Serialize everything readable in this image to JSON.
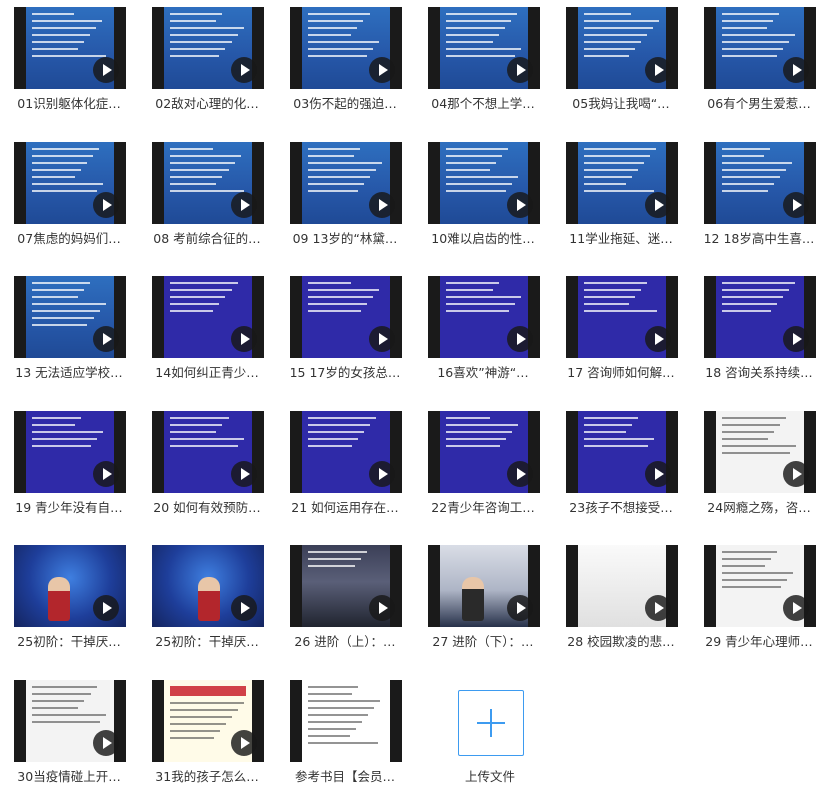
{
  "files": [
    {
      "name": "01识别躯体化症…",
      "style": "blue-doc"
    },
    {
      "name": "02敌对心理的化…",
      "style": "blue"
    },
    {
      "name": "03伤不起的强迫…",
      "style": "blue"
    },
    {
      "name": "04那个不想上学…",
      "style": "blue"
    },
    {
      "name": "05我妈让我喝“…",
      "style": "blue"
    },
    {
      "name": "06有个男生爱惹…",
      "style": "blue"
    },
    {
      "name": "07焦虑的妈妈们…",
      "style": "blue"
    },
    {
      "name": "08 考前综合征的…",
      "style": "blue"
    },
    {
      "name": "09 13岁的“林黛…",
      "style": "blue"
    },
    {
      "name": "10难以启齿的性…",
      "style": "blue"
    },
    {
      "name": "11学业拖延、迷…",
      "style": "blue"
    },
    {
      "name": "12 18岁高中生喜…",
      "style": "blue"
    },
    {
      "name": "13 无法适应学校…",
      "style": "blue"
    },
    {
      "name": "14如何纠正青少…",
      "style": "indigo"
    },
    {
      "name": "15 17岁的女孩总…",
      "style": "indigo"
    },
    {
      "name": "16喜欢”神游“…",
      "style": "indigo"
    },
    {
      "name": "17 咨询师如何解…",
      "style": "indigo"
    },
    {
      "name": "18 咨询关系持续…",
      "style": "indigo"
    },
    {
      "name": "19 青少年没有自…",
      "style": "indigo"
    },
    {
      "name": "20 如何有效预防…",
      "style": "indigo"
    },
    {
      "name": "21 如何运用存在…",
      "style": "indigo"
    },
    {
      "name": "22青少年咨询工…",
      "style": "indigo"
    },
    {
      "name": "23孩子不想接受…",
      "style": "indigo"
    },
    {
      "name": "24网瘾之殇，咨…",
      "style": "white"
    },
    {
      "name": "25初阶：干掉厌…",
      "style": "photo"
    },
    {
      "name": "25初阶：干掉厌…",
      "style": "photo"
    },
    {
      "name": "26 进阶（上）：…",
      "style": "hall"
    },
    {
      "name": "27 进阶（下）：…",
      "style": "stage"
    },
    {
      "name": "28 校园欺凌的悲…",
      "style": "plain"
    },
    {
      "name": "29 青少年心理师…",
      "style": "white"
    },
    {
      "name": "30当疫情碰上开…",
      "style": "whiteslide"
    },
    {
      "name": "31我的孩子怎么…",
      "style": "cream"
    },
    {
      "name": "参考书目【会员…",
      "style": "doc"
    }
  ],
  "upload": {
    "label": "上传文件"
  }
}
